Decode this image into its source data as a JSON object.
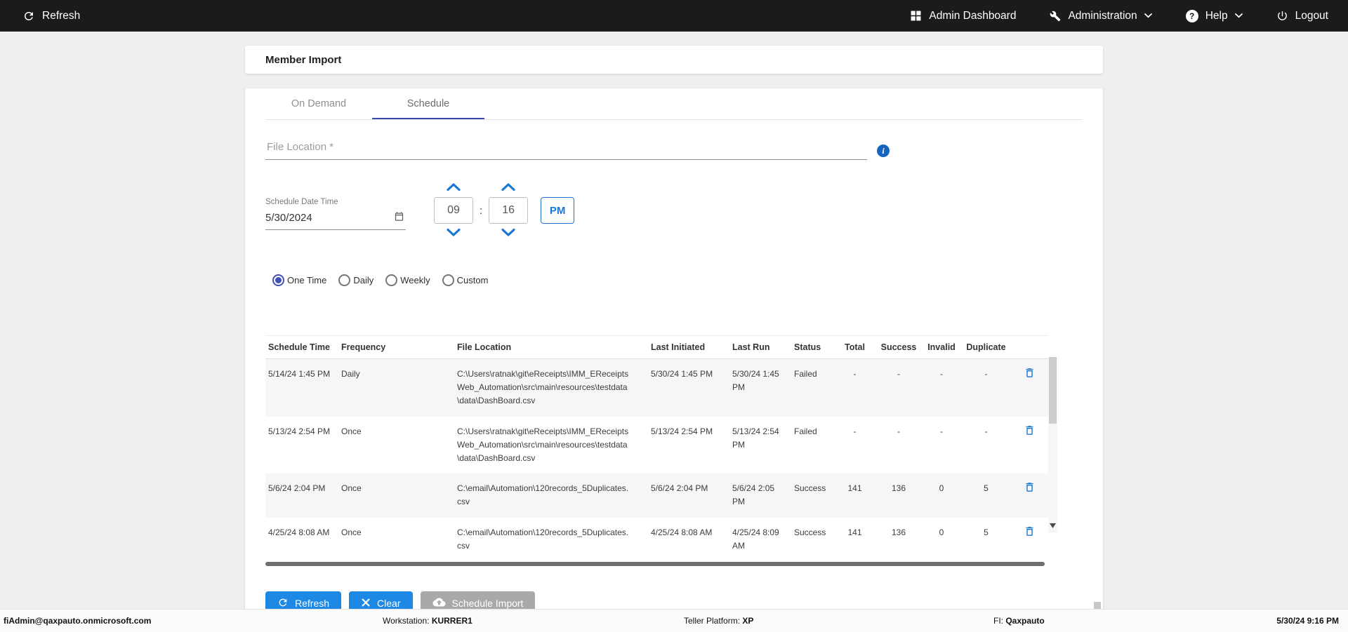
{
  "topbar": {
    "refresh_label": "Refresh",
    "admin_dashboard_label": "Admin Dashboard",
    "administration_label": "Administration",
    "help_label": "Help",
    "logout_label": "Logout"
  },
  "page": {
    "title": "Member Import"
  },
  "tabs": {
    "on_demand": "On Demand",
    "schedule": "Schedule"
  },
  "form": {
    "file_location_placeholder": "File Location *",
    "schedule_datetime_label": "Schedule Date Time",
    "date_value": "5/30/2024",
    "hour_value": "09",
    "minute_value": "16",
    "time_separator": ":",
    "meridiem_label": "PM",
    "frequency_options": [
      "One Time",
      "Daily",
      "Weekly",
      "Custom"
    ],
    "frequency_selected": "One Time"
  },
  "table": {
    "headers": [
      "Schedule Time",
      "Frequency",
      "File Location",
      "Last Initiated",
      "Last Run",
      "Status",
      "Total",
      "Success",
      "Invalid",
      "Duplicate"
    ],
    "rows": [
      {
        "schedule_time": "5/14/24 1:45 PM",
        "frequency": "Daily",
        "file_location": "C:\\Users\\ratnak\\git\\eReceipts\\IMM_EReceiptsWeb_Automation\\src\\main\\resources\\testdata\\data\\DashBoard.csv",
        "last_initiated": "5/30/24 1:45 PM",
        "last_run": "5/30/24 1:45 PM",
        "status": "Failed",
        "total": "-",
        "success": "-",
        "invalid": "-",
        "duplicate": "-"
      },
      {
        "schedule_time": "5/13/24 2:54 PM",
        "frequency": "Once",
        "file_location": "C:\\Users\\ratnak\\git\\eReceipts\\IMM_EReceiptsWeb_Automation\\src\\main\\resources\\testdata\\data\\DashBoard.csv",
        "last_initiated": "5/13/24 2:54 PM",
        "last_run": "5/13/24 2:54 PM",
        "status": "Failed",
        "total": "-",
        "success": "-",
        "invalid": "-",
        "duplicate": "-"
      },
      {
        "schedule_time": "5/6/24 2:04 PM",
        "frequency": "Once",
        "file_location": "C:\\email\\Automation\\120records_5Duplicates.csv",
        "last_initiated": "5/6/24 2:04 PM",
        "last_run": "5/6/24 2:05 PM",
        "status": "Success",
        "total": "141",
        "success": "136",
        "invalid": "0",
        "duplicate": "5"
      },
      {
        "schedule_time": "4/25/24 8:08 AM",
        "frequency": "Once",
        "file_location": "C:\\email\\Automation\\120records_5Duplicates.csv",
        "last_initiated": "4/25/24 8:08 AM",
        "last_run": "4/25/24 8:09 AM",
        "status": "Success",
        "total": "141",
        "success": "136",
        "invalid": "0",
        "duplicate": "5"
      }
    ]
  },
  "actions": {
    "refresh_label": "Refresh",
    "clear_label": "Clear",
    "schedule_import_label": "Schedule Import"
  },
  "footer": {
    "user_email": "fiAdmin@qaxpauto.onmicrosoft.com",
    "workstation_label": "Workstation:",
    "workstation_value": "KURRER1",
    "teller_platform_label": "Teller Platform:",
    "teller_platform_value": "XP",
    "fi_label": "FI:",
    "fi_value": "Qaxpauto",
    "datetime": "5/30/24 9:16 PM"
  },
  "colors": {
    "topbar_bg": "#1b1b1b",
    "accent_blue": "#1e88e5",
    "control_blue": "#1976d2",
    "tab_indigo": "#3949ab",
    "disabled_gray": "#a9a9a9"
  }
}
